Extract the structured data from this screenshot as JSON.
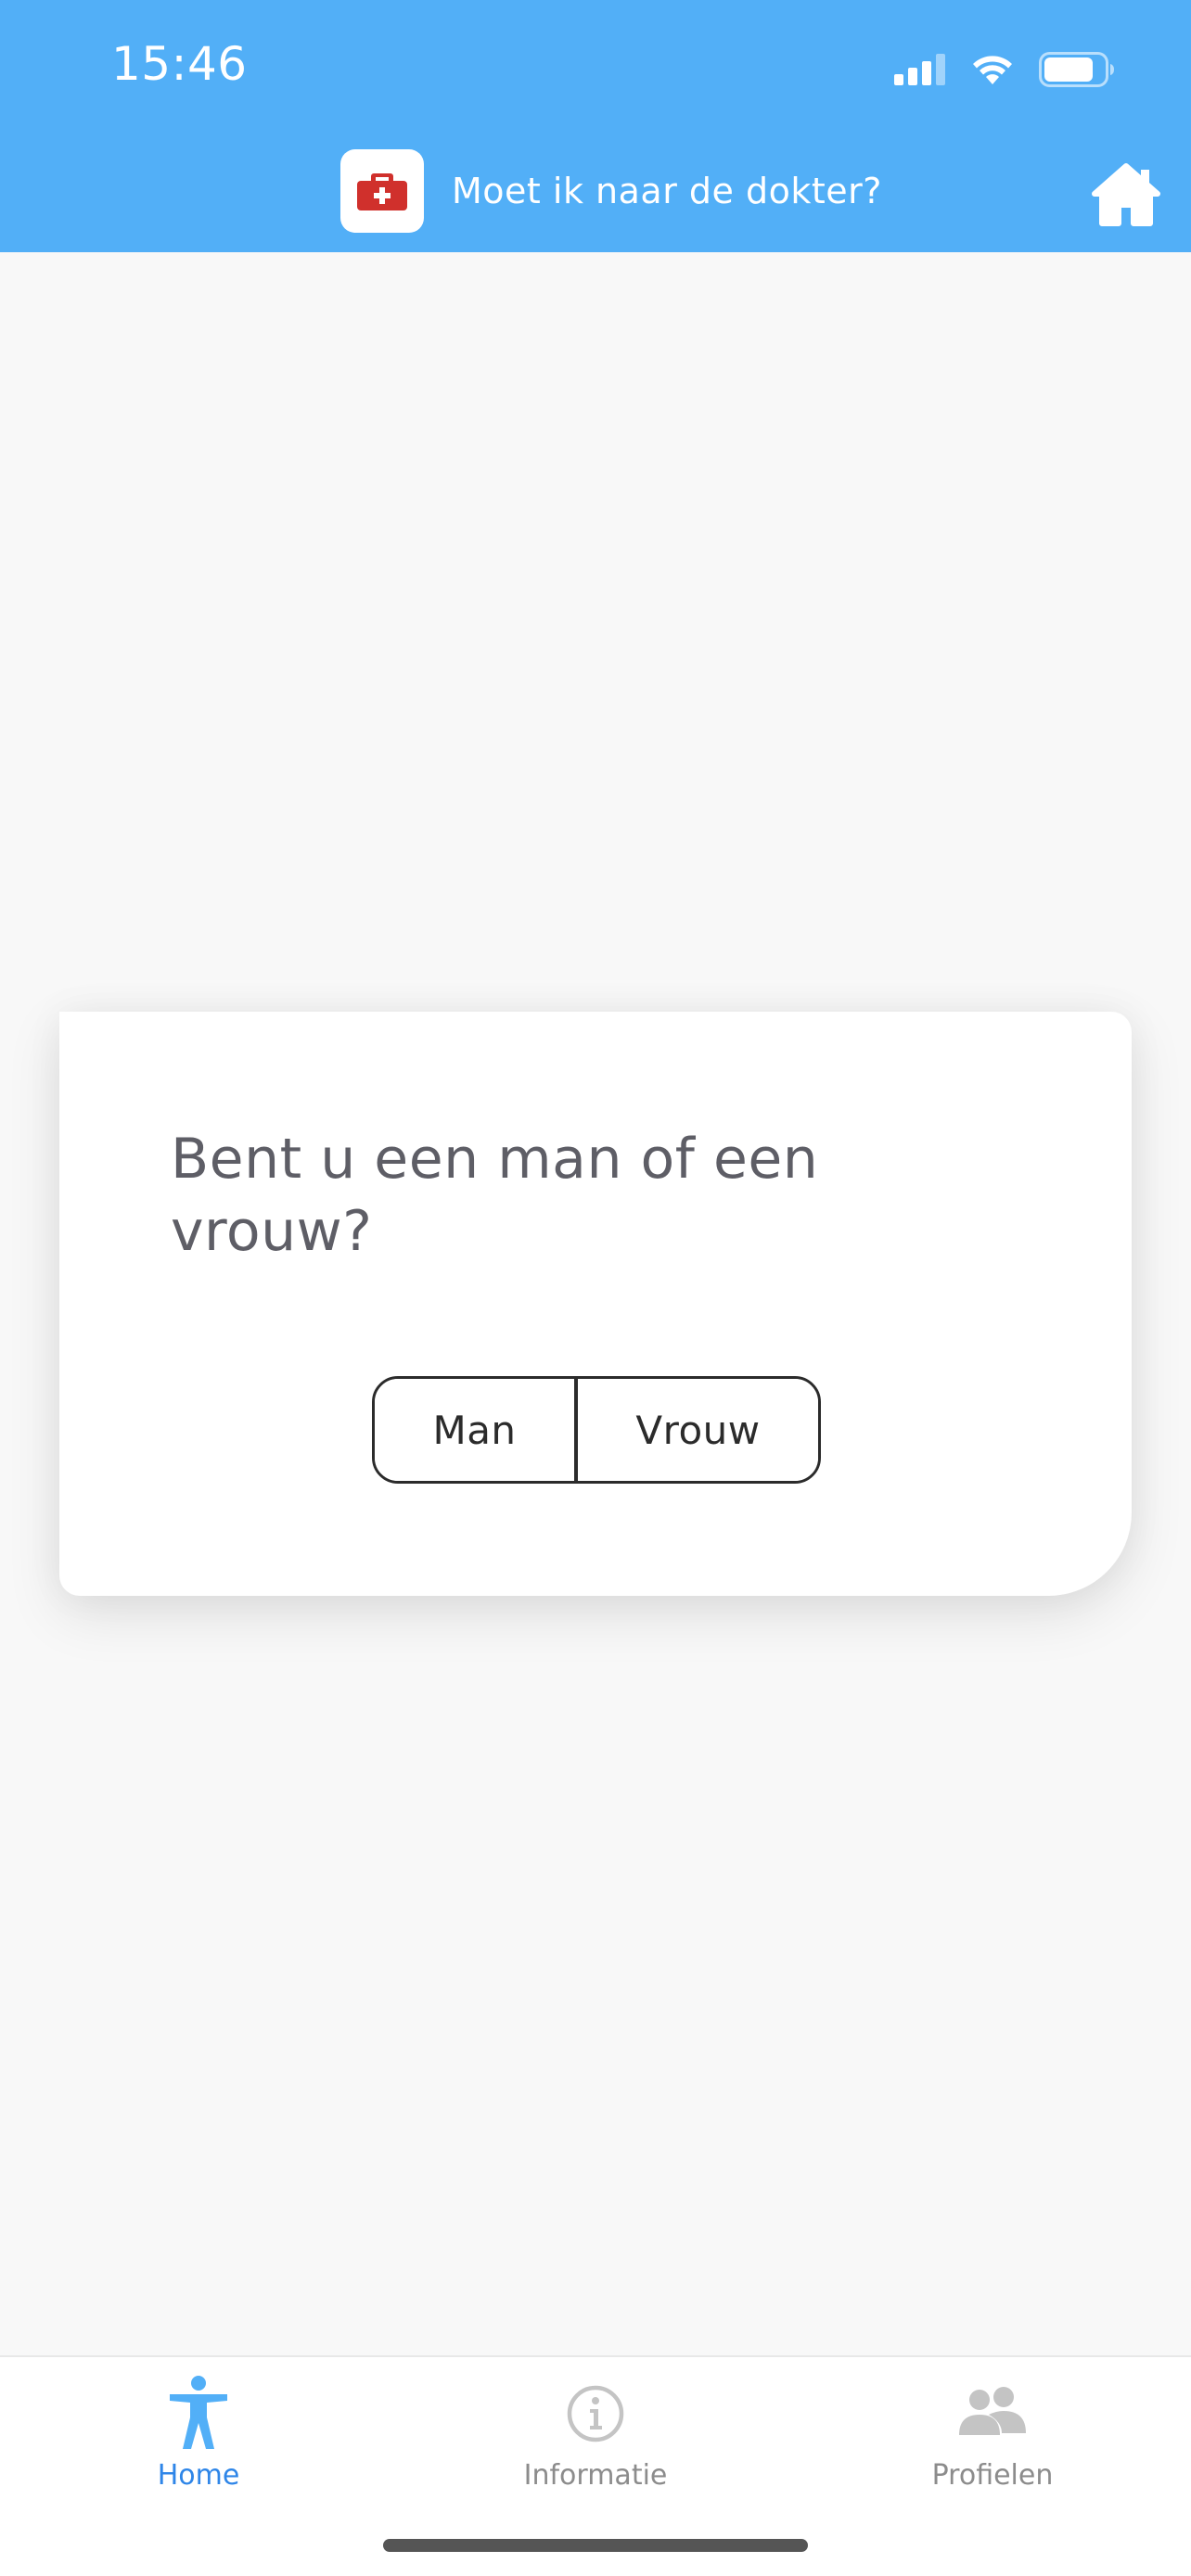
{
  "status_bar": {
    "time": "15:46",
    "icons": [
      "signal-icon",
      "wifi-icon",
      "battery-icon"
    ]
  },
  "header": {
    "logo_icon": "first-aid-kit-icon",
    "title": "Moet ik naar de dokter?",
    "home_icon": "home-icon"
  },
  "colors": {
    "header_bg": "#52aff7",
    "accent": "#2f86e8",
    "logo_red": "#d0302c",
    "inactive": "#c4c4c4"
  },
  "question": {
    "text": "Bent u een man of een vrouw?",
    "options": {
      "man": "Man",
      "vrouw": "Vrouw"
    }
  },
  "tabs": [
    {
      "label": "Home",
      "icon": "person-icon",
      "active": true
    },
    {
      "label": "Informatie",
      "icon": "info-icon",
      "active": false
    },
    {
      "label": "Profielen",
      "icon": "people-icon",
      "active": false
    }
  ]
}
